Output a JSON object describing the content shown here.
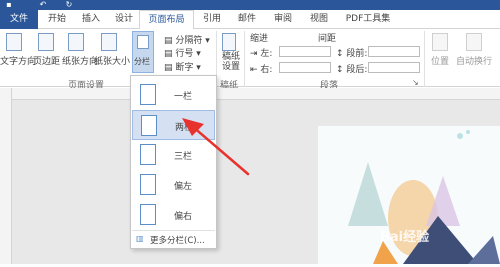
{
  "tabs": [
    "开始",
    "插入",
    "设计",
    "页面布局",
    "引用",
    "邮件",
    "审阅",
    "视图",
    "PDF工具集"
  ],
  "file_tab": "文件",
  "ribbon": {
    "text_direction": "文字方向",
    "margins": "页边距",
    "orientation": "纸张方向",
    "size": "纸张大小",
    "columns": "分栏",
    "breaks": "分隔符",
    "line_numbers": "行号",
    "hyphenation": "断字",
    "manuscript": "稿纸设置",
    "page_setup_group": "页面设置",
    "manuscript_group": "稿纸",
    "indent_title": "缩进",
    "indent_left": "左:",
    "indent_right": "右:",
    "spacing_title": "间距",
    "spacing_before": "段前:",
    "spacing_after": "段后:",
    "paragraph_group": "段落",
    "position": "位置",
    "wrap_text": "自动换行"
  },
  "dropdown": {
    "items": [
      "一栏",
      "两栏",
      "三栏",
      "偏左",
      "偏右"
    ],
    "more": "更多分栏(C)..."
  },
  "watermark": "Bai经验",
  "accent": "#2b579a",
  "highlight": "#d5e1f2",
  "arrow_color": "#e8322d"
}
